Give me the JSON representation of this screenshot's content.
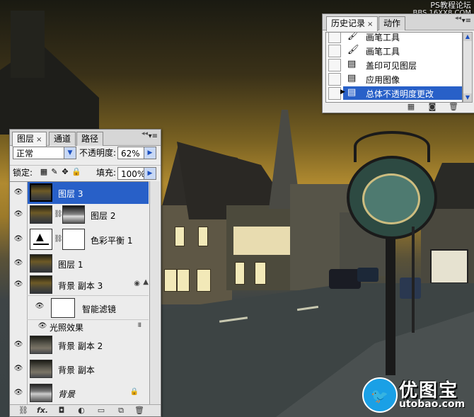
{
  "watermark": {
    "top_line1": "PS教程论坛",
    "top_line2": "BBS.16XX8.COM",
    "brand_cn": "优图宝",
    "brand_url": "utobao.com"
  },
  "history_panel": {
    "tabs": [
      {
        "label": "历史记录",
        "close": "×"
      },
      {
        "label": "动作"
      }
    ],
    "items": [
      {
        "label": "画笔工具",
        "icon": "brush-icon"
      },
      {
        "label": "画笔工具",
        "icon": "brush-icon"
      },
      {
        "label": "盖印可见图层",
        "icon": "document-icon"
      },
      {
        "label": "应用图像",
        "icon": "document-icon"
      },
      {
        "label": "总体不透明度更改",
        "icon": "document-icon",
        "selected": true
      }
    ],
    "footer_icons": [
      "new-document-from-state-icon",
      "new-snapshot-icon",
      "delete-state-icon"
    ],
    "accent_color": "#2860c8"
  },
  "layers_panel": {
    "tabs": [
      {
        "label": "图层",
        "close": "×"
      },
      {
        "label": "通道"
      },
      {
        "label": "路径"
      }
    ],
    "blend_mode": "正常",
    "opacity_label": "不透明度:",
    "opacity_value": "62%",
    "lock_label": "锁定:",
    "fill_label": "填充:",
    "fill_value": "100%",
    "layers": [
      {
        "name": "图层 3",
        "selected": true
      },
      {
        "name": "图层 2",
        "has_mask": true
      },
      {
        "name": "色彩平衡 1",
        "adjustment": true
      },
      {
        "name": "图层 1"
      },
      {
        "name": "背景 副本 3",
        "smart_object": true
      },
      {
        "name": "智能滤镜",
        "sub": true
      },
      {
        "name": "光照效果",
        "filter": true
      },
      {
        "name": "背景 副本 2"
      },
      {
        "name": "背景 副本"
      },
      {
        "name": "背景",
        "locked": true
      }
    ],
    "footer_icons": [
      "link-layers-icon",
      "fx-icon",
      "add-mask-icon",
      "adjustment-layer-icon",
      "new-group-icon",
      "new-layer-icon",
      "trash-icon"
    ],
    "fx_label": "fx."
  }
}
